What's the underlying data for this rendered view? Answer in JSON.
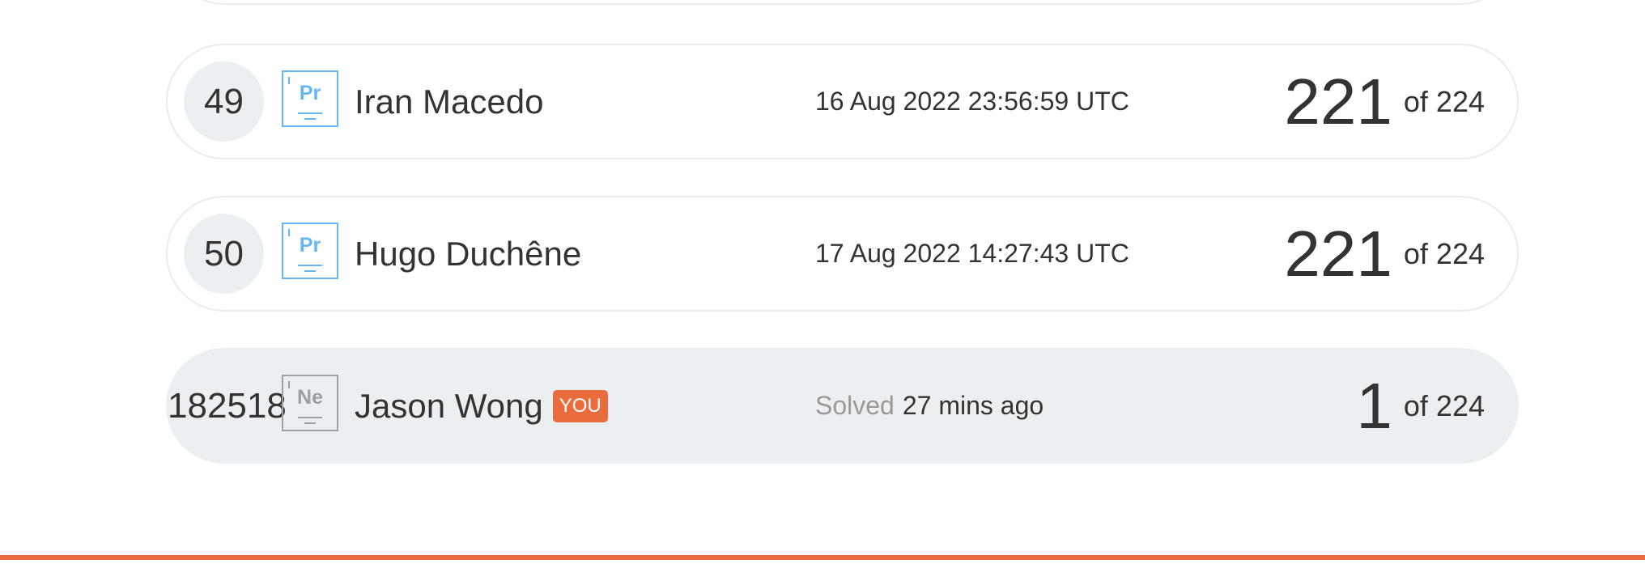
{
  "leaderboard": {
    "rows": [
      {
        "rank": "49",
        "badge": "Pr",
        "name": "Iran Macedo",
        "time": "16 Aug 2022 23:56:59 UTC",
        "score": "221",
        "total": "of 224"
      },
      {
        "rank": "50",
        "badge": "Pr",
        "name": "Hugo Duchêne",
        "time": "17 Aug 2022 14:27:43 UTC",
        "score": "221",
        "total": "of 224"
      }
    ],
    "current_user": {
      "rank": "182518",
      "badge": "Ne",
      "name": "Jason Wong",
      "you_label": "YOU",
      "time_prefix": "Solved",
      "time": "27 mins ago",
      "score": "1",
      "total": "of 224"
    }
  },
  "colors": {
    "accent": "#ea6c3c",
    "badge_blue": "#64b8ef",
    "badge_grey": "#9aa0a4",
    "highlight_row": "#eceff1"
  }
}
